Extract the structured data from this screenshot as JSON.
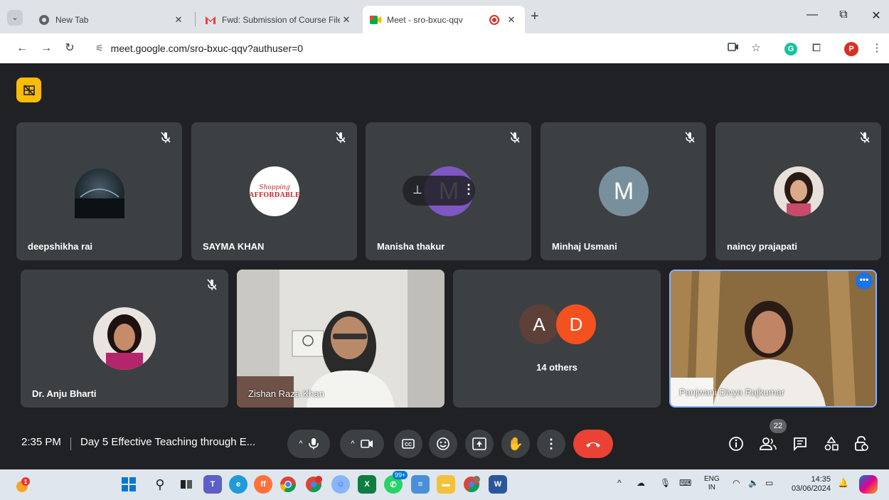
{
  "browser": {
    "tabs": [
      {
        "title": "New Tab",
        "icon": "chrome-icon"
      },
      {
        "title": "Fwd: Submission of Course File",
        "icon": "gmail-icon"
      },
      {
        "title": "Meet - sro-bxuc-qqv",
        "icon": "meet-icon"
      }
    ],
    "url": "meet.google.com/sro-bxuc-qqv?authuser=0",
    "profile_initial": "P"
  },
  "meet": {
    "participants_row1": [
      {
        "name": "deepshikha rai",
        "avatar": "photo-horizon"
      },
      {
        "name": "SAYMA KHAN",
        "avatar": "logo-affordable"
      },
      {
        "name": "Manisha thakur",
        "avatar_letter": "M"
      },
      {
        "name": "Minhaj Usmani",
        "avatar_letter": "M"
      },
      {
        "name": "naincy prajapati",
        "avatar": "photo-woman"
      }
    ],
    "participants_row2": [
      {
        "name": "Dr. Anju Bharti"
      },
      {
        "name": "Zishan Raza Khan"
      },
      {
        "name": "14 others",
        "avatars": [
          "A",
          "D"
        ]
      },
      {
        "name": "Panjwani Divya Rajkumar"
      }
    ],
    "logo_text": "AFFORDABLE",
    "logo_script": "Shopping",
    "time": "2:35 PM",
    "meeting_title": "Day 5 Effective Teaching through E...",
    "people_count": "22",
    "colors": {
      "accent": "#8ab4f8",
      "end_call": "#ea4335",
      "layout_button": "#fbbc04"
    }
  },
  "taskbar": {
    "notification_badge": "1",
    "whatsapp_badge": "99+",
    "lang_top": "ENG",
    "lang_bottom": "IN",
    "clock_time": "14:35",
    "clock_date": "03/06/2024"
  }
}
